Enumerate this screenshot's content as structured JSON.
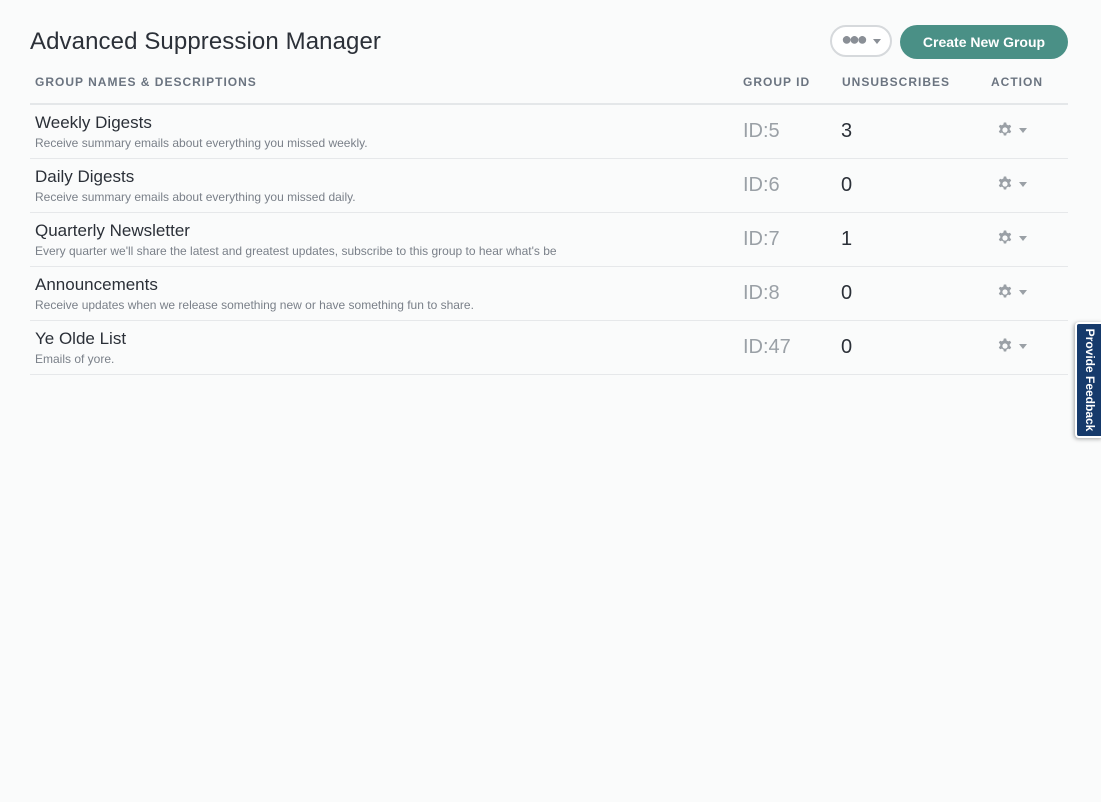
{
  "header": {
    "title": "Advanced Suppression Manager",
    "more_button_glyph": "●●●",
    "create_button_label": "Create New Group"
  },
  "table": {
    "columns": {
      "name": "GROUP NAMES & DESCRIPTIONS",
      "id": "GROUP ID",
      "unsubscribes": "UNSUBSCRIBES",
      "action": "ACTION"
    },
    "rows": [
      {
        "name": "Weekly Digests",
        "description": "Receive summary emails about everything you missed weekly.",
        "id": "ID:5",
        "unsubscribes": "3"
      },
      {
        "name": "Daily Digests",
        "description": "Receive summary emails about everything you missed daily.",
        "id": "ID:6",
        "unsubscribes": "0"
      },
      {
        "name": "Quarterly Newsletter",
        "description": "Every quarter we'll share the latest and greatest updates, subscribe to this group to hear what's be",
        "id": "ID:7",
        "unsubscribes": "1"
      },
      {
        "name": "Announcements",
        "description": "Receive updates when we release something new or have something fun to share.",
        "id": "ID:8",
        "unsubscribes": "0"
      },
      {
        "name": "Ye Olde List",
        "description": "Emails of yore.",
        "id": "ID:47",
        "unsubscribes": "0"
      }
    ]
  },
  "feedback": {
    "label": "Provide Feedback"
  },
  "icons": {
    "more": "ellipsis-icon",
    "action": "gear-icon",
    "dropdown": "caret-down-icon"
  },
  "colors": {
    "accent": "#4a9086",
    "feedback_tab": "#163a6b",
    "background": "#fafbfb"
  }
}
